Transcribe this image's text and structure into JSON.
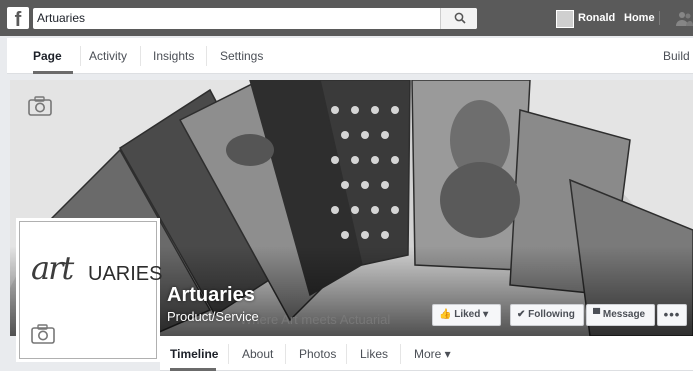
{
  "topbar": {
    "logo": "f",
    "search_value": "Artuaries",
    "user_name": "Ronald",
    "home_label": "Home"
  },
  "admin_tabs": [
    {
      "label": "Page",
      "active": true
    },
    {
      "label": "Activity"
    },
    {
      "label": "Insights"
    },
    {
      "label": "Settings"
    }
  ],
  "admin_build_label": "Build",
  "profile": {
    "logo_script": "art",
    "logo_caps": "UARIES"
  },
  "page": {
    "name": "Artuaries",
    "category": "Product/Service",
    "tagline": "Where Art meets Actuarial"
  },
  "actions": {
    "liked": "Liked",
    "following": "Following",
    "message": "Message",
    "more": "•••"
  },
  "page_tabs": [
    {
      "label": "Timeline",
      "active": true
    },
    {
      "label": "About"
    },
    {
      "label": "Photos"
    },
    {
      "label": "Likes"
    },
    {
      "label": "More ▾"
    }
  ],
  "icons": {
    "search": "search-icon",
    "camera": "camera-icon",
    "thumb": "thumbs-up-icon",
    "check": "check-icon",
    "message": "message-icon"
  }
}
